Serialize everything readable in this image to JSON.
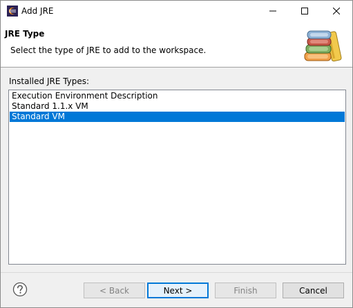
{
  "window": {
    "title": "Add JRE",
    "icon": "eclipse-icon"
  },
  "header": {
    "title": "JRE Type",
    "description": "Select the type of JRE to add to the workspace.",
    "graphic": "books-graphic"
  },
  "list": {
    "label": "Installed JRE Types:",
    "items": [
      {
        "label": "Execution Environment Description",
        "selected": false
      },
      {
        "label": "Standard 1.1.x VM",
        "selected": false
      },
      {
        "label": "Standard VM",
        "selected": true
      }
    ]
  },
  "buttons": {
    "back": "< Back",
    "next": "Next >",
    "finish": "Finish",
    "cancel": "Cancel"
  },
  "colors": {
    "selection": "#0078d7",
    "default_button_border": "#0078d7"
  }
}
